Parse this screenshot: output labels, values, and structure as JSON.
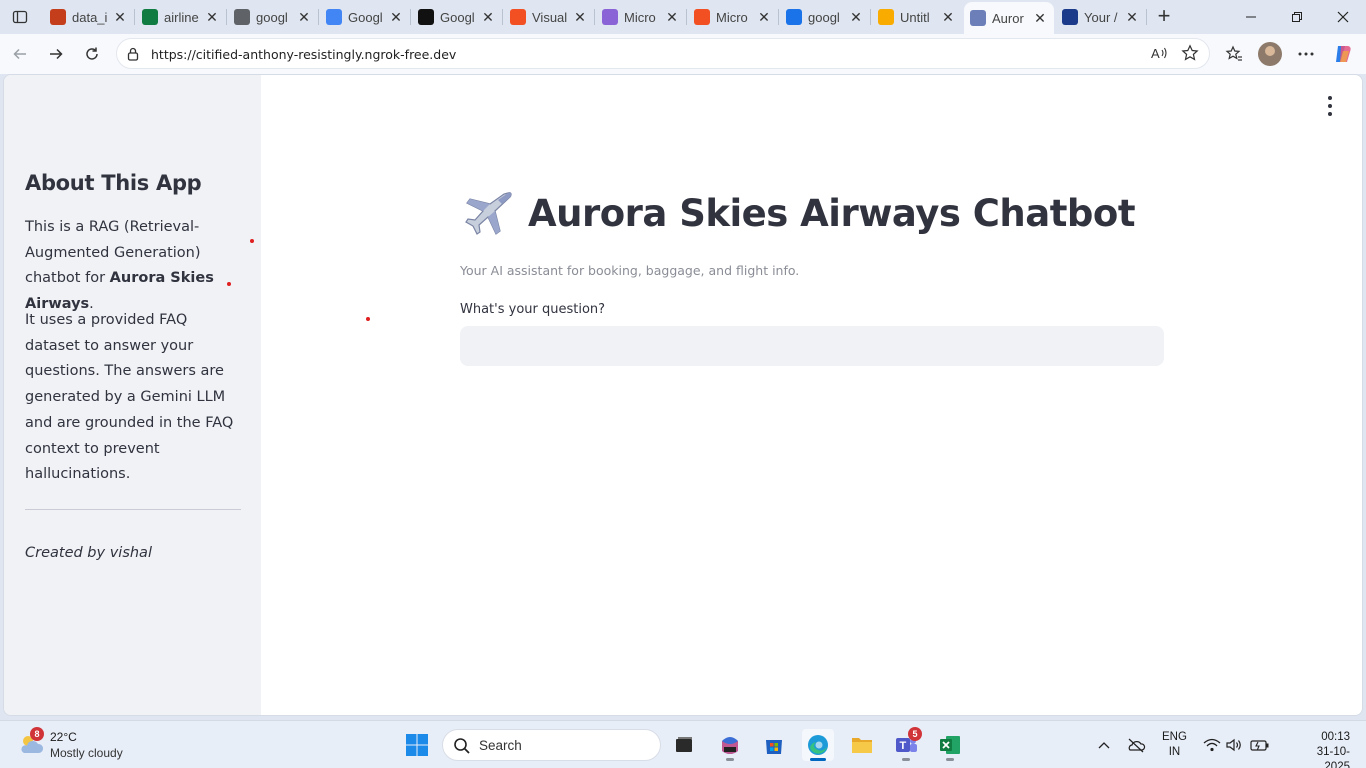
{
  "browser": {
    "tabs": [
      {
        "title": "data_i",
        "favicon": "pdf-icon",
        "color": "#c43e1c"
      },
      {
        "title": "airline",
        "favicon": "excel-icon",
        "color": "#107c41"
      },
      {
        "title": "googl",
        "favicon": "search-icon",
        "color": "#5f6368"
      },
      {
        "title": "Googl",
        "favicon": "google-icon",
        "color": "#4285f4"
      },
      {
        "title": "Googl",
        "favicon": "github-icon",
        "color": "#111111"
      },
      {
        "title": "Visual",
        "favicon": "microsoft-icon",
        "color": "#f25022"
      },
      {
        "title": "Micro",
        "favicon": "copilot-icon",
        "color": "#8a64d6"
      },
      {
        "title": "Micro",
        "favicon": "microsoft-icon",
        "color": "#f25022"
      },
      {
        "title": "googl",
        "favicon": "search-icon",
        "color": "#1a73e8"
      },
      {
        "title": "Untitl",
        "favicon": "colab-icon",
        "color": "#f9ab00"
      },
      {
        "title": "Auror",
        "favicon": "plane-icon",
        "color": "#6d7fb8",
        "active": true
      },
      {
        "title": "Your /",
        "favicon": "naukri-icon",
        "color": "#1b3a8a"
      }
    ],
    "url": "https://citified-anthony-resistingly.ngrok-free.dev",
    "read_aloud": "A  "
  },
  "sidebar": {
    "heading": "About This App",
    "p1_prefix": "This is a RAG (Retrieval-Augmented Generation) chatbot for ",
    "p1_bold": "Aurora Skies Airways",
    "p1_suffix": ".",
    "p2": "It uses a provided FAQ dataset to answer your questions. The answers are generated by a Gemini LLM and are grounded in the FAQ context to prevent hallucinations.",
    "credit": "Created by vishal"
  },
  "main": {
    "title": "Aurora Skies Airways Chatbot",
    "subtitle": "Your AI assistant for booking, baggage, and flight info.",
    "question_label": "What's your question?",
    "question_value": ""
  },
  "taskbar": {
    "weather_badge": "8",
    "temperature": "22°C",
    "condition": "Mostly cloudy",
    "search_placeholder": "Search",
    "teams_badge": "5",
    "lang_line1": "ENG",
    "lang_line2": "IN",
    "time": "00:13",
    "date": "31-10-2025"
  },
  "colors": {
    "streamlit_text": "#31333f",
    "sidebar_bg": "#f0f2f6",
    "accent_blue": "#0067c0"
  }
}
